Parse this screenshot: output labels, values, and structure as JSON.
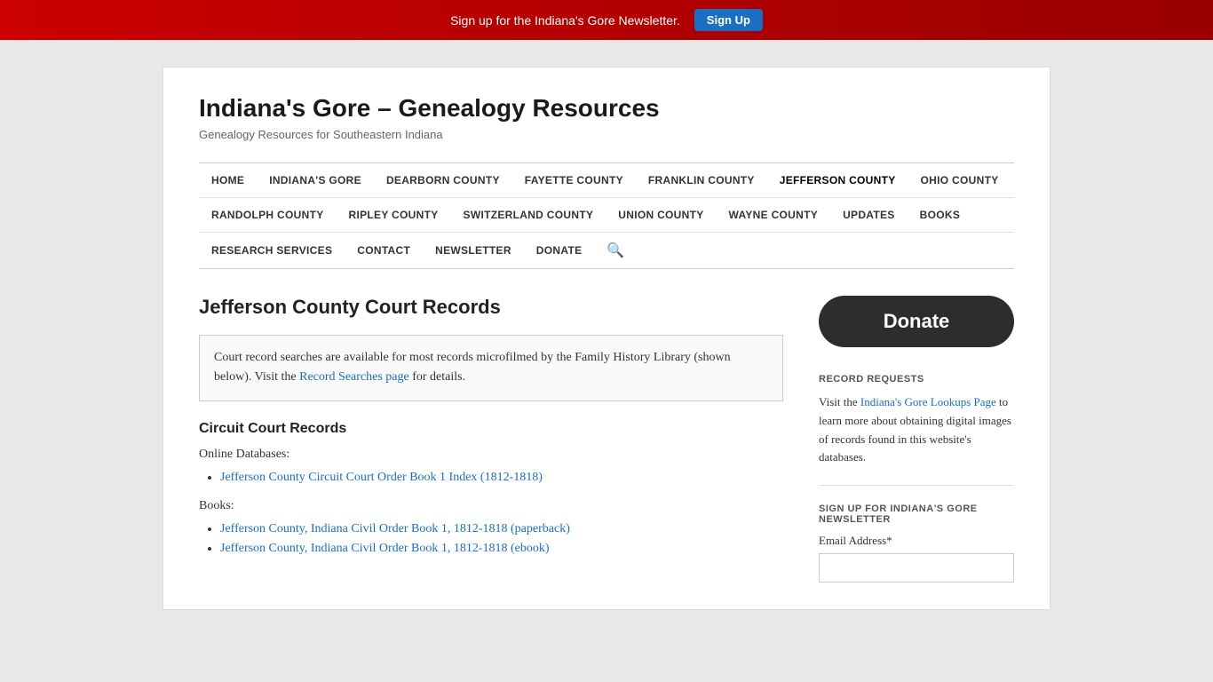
{
  "banner": {
    "text": "Sign up for the Indiana's Gore Newsletter.",
    "button": "Sign Up"
  },
  "site": {
    "title": "Indiana's Gore – Genealogy Resources",
    "subtitle": "Genealogy Resources for Southeastern Indiana"
  },
  "nav": {
    "row1": [
      {
        "label": "HOME",
        "active": false
      },
      {
        "label": "INDIANA'S GORE",
        "active": false
      },
      {
        "label": "DEARBORN COUNTY",
        "active": false
      },
      {
        "label": "FAYETTE COUNTY",
        "active": false
      },
      {
        "label": "FRANKLIN COUNTY",
        "active": false
      },
      {
        "label": "JEFFERSON COUNTY",
        "active": true
      },
      {
        "label": "OHIO COUNTY",
        "active": false
      }
    ],
    "row2": [
      {
        "label": "RANDOLPH COUNTY",
        "active": false
      },
      {
        "label": "RIPLEY COUNTY",
        "active": false
      },
      {
        "label": "SWITZERLAND COUNTY",
        "active": false
      },
      {
        "label": "UNION COUNTY",
        "active": false
      },
      {
        "label": "WAYNE COUNTY",
        "active": false
      },
      {
        "label": "UPDATES",
        "active": false
      },
      {
        "label": "BOOKS",
        "active": false
      }
    ],
    "row3": [
      {
        "label": "RESEARCH SERVICES",
        "active": false
      },
      {
        "label": "CONTACT",
        "active": false
      },
      {
        "label": "NEWSLETTER",
        "active": false
      },
      {
        "label": "DONATE",
        "active": false
      }
    ]
  },
  "page": {
    "heading": "Jefferson County Court Records",
    "info_box": {
      "text_before": "Court record searches are available for most records microfilmed by the Family History Library (shown below). Visit the ",
      "link_text": "Record Searches page",
      "text_after": " for details."
    },
    "circuit_court": {
      "heading": "Circuit Court Records",
      "online_label": "Online Databases:",
      "online_links": [
        {
          "text": "Jefferson County Circuit Court Order Book 1 Index (1812-1818)",
          "href": "#"
        }
      ],
      "books_label": "Books:",
      "book_links": [
        {
          "text": "Jefferson County, Indiana Civil Order Book 1, 1812-1818 (paperback)",
          "href": "#"
        },
        {
          "text": "Jefferson County, Indiana Civil Order Book 1, 1812-1818 (ebook)",
          "href": "#"
        }
      ]
    }
  },
  "sidebar": {
    "donate_label": "Donate",
    "record_requests": {
      "title": "RECORD REQUESTS",
      "text_before": "Visit the ",
      "link_text": "Indiana's Gore Lookups Page",
      "text_after": " to learn more about obtaining digital images of records found in this website's databases."
    },
    "newsletter": {
      "title": "SIGN UP FOR INDIANA'S GORE NEWSLETTER",
      "email_label": "Email Address*",
      "email_placeholder": ""
    }
  }
}
